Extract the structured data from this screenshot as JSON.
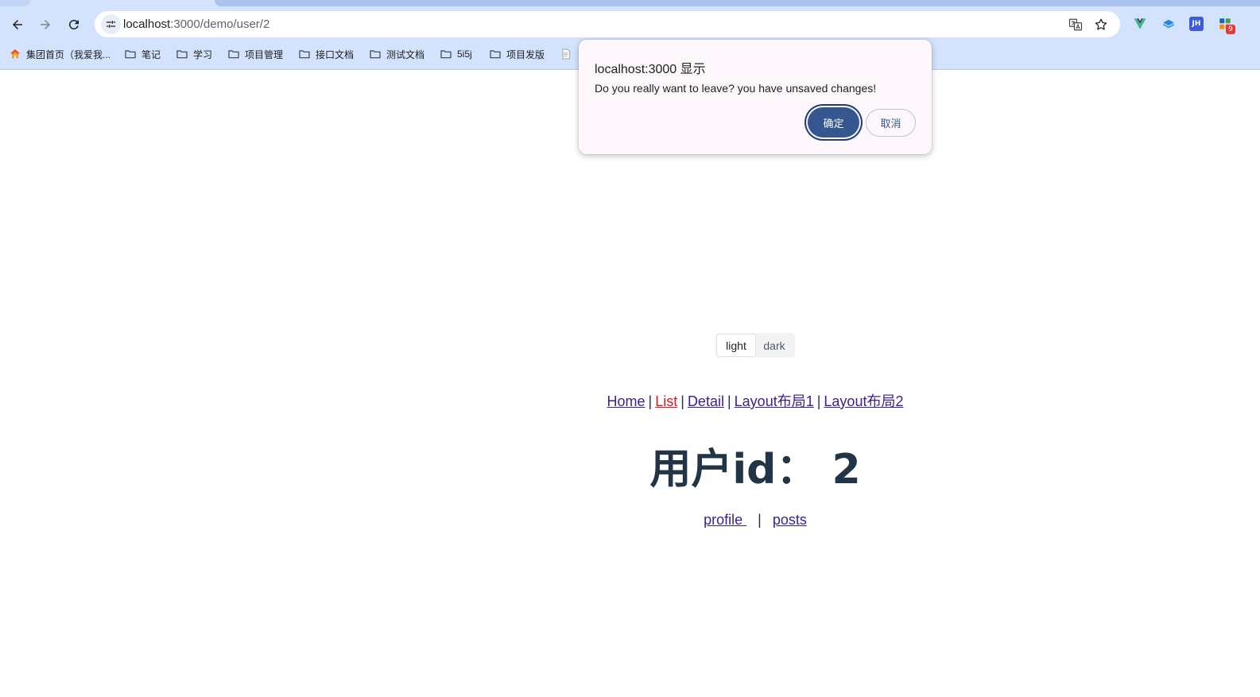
{
  "browser": {
    "url_host": "localhost",
    "url_rest": ":3000/demo/user/2",
    "bookmarks": [
      {
        "label": "集团首页（我爱我...",
        "icon": "house-icon"
      },
      {
        "label": "笔记",
        "icon": "folder-icon"
      },
      {
        "label": "学习",
        "icon": "folder-icon"
      },
      {
        "label": "项目管理",
        "icon": "folder-icon"
      },
      {
        "label": "接口文档",
        "icon": "folder-icon"
      },
      {
        "label": "测试文档",
        "icon": "folder-icon"
      },
      {
        "label": "5i5j",
        "icon": "folder-icon"
      },
      {
        "label": "项目发版",
        "icon": "folder-icon"
      }
    ],
    "extension_jh_label": "JH",
    "extension_badge_count": "9",
    "colors": {
      "chrome_bg": "#d3e3fd",
      "vue_green": "#41b883"
    }
  },
  "page": {
    "theme": {
      "light_label": "light",
      "dark_label": "dark",
      "selected": "light"
    },
    "nav": {
      "home": "Home",
      "list": "List",
      "detail": "Detail",
      "layout1": "Layout布局1",
      "layout2": "Layout布局2",
      "separator": "|"
    },
    "title": "用户id： 2",
    "sub_nav": {
      "profile": "profile ",
      "posts": "posts",
      "separator": "|"
    },
    "colors": {
      "text": "#213547",
      "link": "#3c1f8f",
      "active_link": "#e8141b"
    }
  },
  "dialog": {
    "title": "localhost:3000 显示",
    "message": "Do you really want to leave? you have unsaved changes!",
    "ok_label": "确定",
    "cancel_label": "取消",
    "colors": {
      "primary": "#35568f",
      "background": "#fdf7fc"
    }
  }
}
